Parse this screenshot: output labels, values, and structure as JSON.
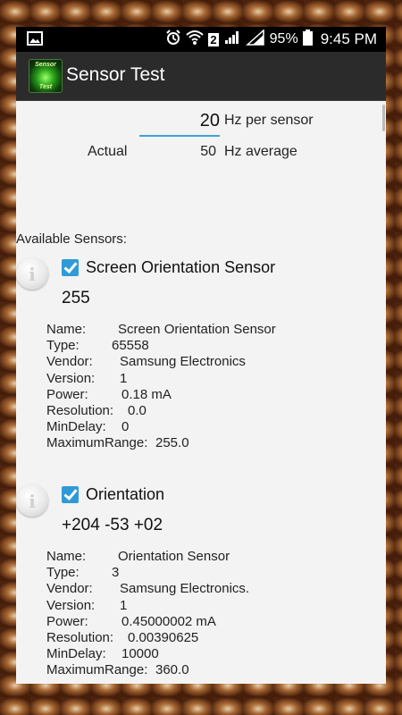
{
  "status_bar": {
    "battery_percent": "95%",
    "sim_badge": "2",
    "time": "9:45 PM"
  },
  "app_bar": {
    "icon_text_top": "Sensor",
    "icon_text_bottom": "Test",
    "title": "Sensor Test"
  },
  "rate": {
    "value": "20",
    "unit_label": "Hz per sensor",
    "actual_label": "Actual",
    "actual_value": "50",
    "actual_unit": "Hz average"
  },
  "available_label": "Available Sensors:",
  "sensors": [
    {
      "title": "Screen Orientation Sensor",
      "checked": true,
      "value": "255",
      "details": [
        {
          "key": "Name:",
          "value": "Screen Orientation Sensor"
        },
        {
          "key": "Type:",
          "value": "65558"
        },
        {
          "key": "Vendor:",
          "value": "Samsung Electronics"
        },
        {
          "key": "Version:",
          "value": "1"
        },
        {
          "key": "Power:",
          "value": "0.18 mA"
        },
        {
          "key": "Resolution:",
          "value": "0.0"
        },
        {
          "key": "MinDelay:",
          "value": "0"
        },
        {
          "key": "MaximumRange:",
          "value": "255.0"
        }
      ]
    },
    {
      "title": "Orientation",
      "checked": true,
      "value": "+204 -53 +02",
      "details": [
        {
          "key": "Name:",
          "value": "Orientation Sensor"
        },
        {
          "key": "Type:",
          "value": "3"
        },
        {
          "key": "Vendor:",
          "value": "Samsung Electronics."
        },
        {
          "key": "Version:",
          "value": "1"
        },
        {
          "key": "Power:",
          "value": "0.45000002 mA"
        },
        {
          "key": "Resolution:",
          "value": "0.00390625"
        },
        {
          "key": "MinDelay:",
          "value": "10000"
        },
        {
          "key": "MaximumRange:",
          "value": "360.0"
        }
      ]
    }
  ]
}
